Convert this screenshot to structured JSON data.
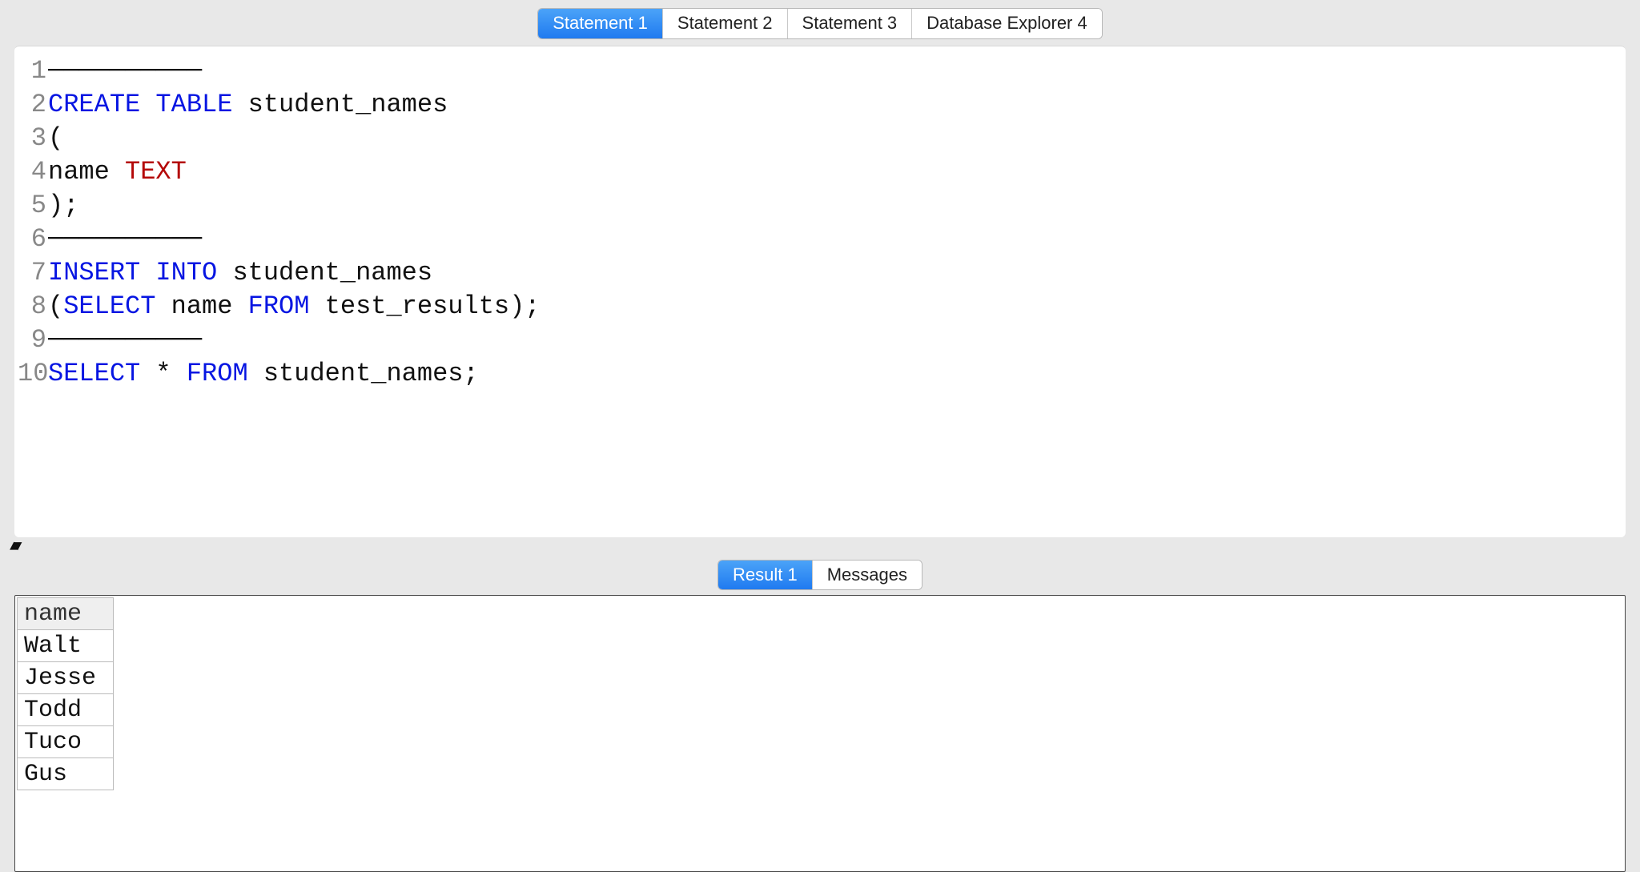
{
  "top_tabs": [
    {
      "label": "Statement 1",
      "active": true
    },
    {
      "label": "Statement 2",
      "active": false
    },
    {
      "label": "Statement 3",
      "active": false
    },
    {
      "label": "Database Explorer 4",
      "active": false
    }
  ],
  "editor_lines": [
    {
      "n": "1",
      "tokens": [
        {
          "t": "──────────",
          "c": "tx"
        }
      ]
    },
    {
      "n": "2",
      "tokens": [
        {
          "t": "CREATE TABLE",
          "c": "kw"
        },
        {
          "t": " student_names",
          "c": "tx"
        }
      ]
    },
    {
      "n": "3",
      "tokens": [
        {
          "t": "(",
          "c": "tx"
        }
      ]
    },
    {
      "n": "4",
      "tokens": [
        {
          "t": "name ",
          "c": "tx"
        },
        {
          "t": "TEXT",
          "c": "ty"
        }
      ]
    },
    {
      "n": "5",
      "tokens": [
        {
          "t": ");",
          "c": "tx"
        }
      ]
    },
    {
      "n": "6",
      "tokens": [
        {
          "t": "──────────",
          "c": "tx"
        }
      ]
    },
    {
      "n": "7",
      "tokens": [
        {
          "t": "INSERT INTO",
          "c": "kw"
        },
        {
          "t": " student_names",
          "c": "tx"
        }
      ]
    },
    {
      "n": "8",
      "tokens": [
        {
          "t": "(",
          "c": "tx"
        },
        {
          "t": "SELECT",
          "c": "kw"
        },
        {
          "t": " name ",
          "c": "tx"
        },
        {
          "t": "FROM",
          "c": "kw"
        },
        {
          "t": " test_results);",
          "c": "tx"
        }
      ]
    },
    {
      "n": "9",
      "tokens": [
        {
          "t": "──────────",
          "c": "tx"
        }
      ]
    },
    {
      "n": "10",
      "tokens": [
        {
          "t": "SELECT",
          "c": "kw"
        },
        {
          "t": " * ",
          "c": "tx"
        },
        {
          "t": "FROM",
          "c": "kw"
        },
        {
          "t": " student_names;",
          "c": "tx"
        }
      ]
    }
  ],
  "result_tabs": [
    {
      "label": "Result 1",
      "active": true
    },
    {
      "label": "Messages",
      "active": false
    }
  ],
  "result_table": {
    "header": "name",
    "rows": [
      "Walt",
      "Jesse",
      "Todd",
      "Tuco",
      "Gus"
    ]
  },
  "splitter_glyph": "▲▼"
}
